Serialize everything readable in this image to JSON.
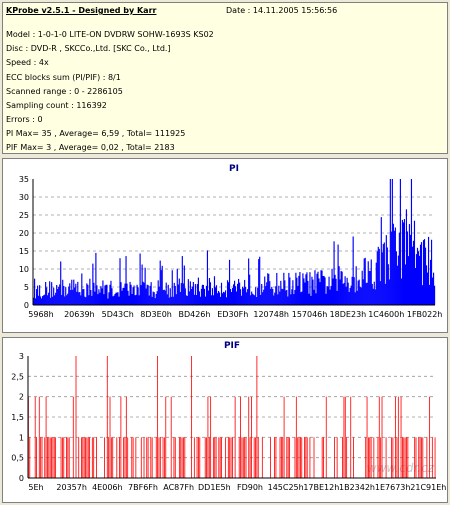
{
  "info": {
    "title": "KProbe v2.5.1 - Designed by Karr",
    "date": "Date : 14.11.2005 15:56:56",
    "lines": [
      "Model : 1-0-1-0 LITE-ON DVDRW SOHW-1693S KS02",
      "Disc : DVD-R , SKCCo.,Ltd. [SKC Co., Ltd.]",
      "Speed : 4x",
      "ECC blocks sum (PI/PIF) : 8/1",
      "Scanned range : 0 - 2286105",
      "Sampling count : 116392",
      "Errors : 0",
      "PI Max= 35 , Average= 6,59 , Total= 111925",
      "PIF Max= 3 , Average= 0,02 , Total= 2183"
    ]
  },
  "watermark": "www.cdr.cz",
  "colors": {
    "pi": "#0000ff",
    "pif": "#ff0000",
    "title": "#000080",
    "info_bg": "#ffffe1"
  },
  "chart_data": [
    {
      "type": "bar",
      "title": "PI",
      "ylim": [
        0,
        35
      ],
      "yticks": [
        "0",
        "5",
        "10",
        "15",
        "20",
        "25",
        "30",
        "35"
      ],
      "xticks": [
        "5968h",
        "20639h",
        "5D43Ch",
        "8D3E0h",
        "BD426h",
        "ED30Fh",
        "120748h",
        "157046h",
        "18DE23h",
        "1C4600h",
        "1FB022h"
      ],
      "grid": true,
      "profile": [
        [
          0,
          4.5
        ],
        [
          0.05,
          5
        ],
        [
          0.1,
          5.5
        ],
        [
          0.2,
          5
        ],
        [
          0.3,
          5
        ],
        [
          0.4,
          5.5
        ],
        [
          0.5,
          6
        ],
        [
          0.6,
          6.5
        ],
        [
          0.7,
          7
        ],
        [
          0.75,
          7.5
        ],
        [
          0.8,
          9
        ],
        [
          0.85,
          12
        ],
        [
          0.88,
          15
        ],
        [
          0.9,
          18
        ],
        [
          0.93,
          20
        ],
        [
          0.96,
          16
        ],
        [
          1.0,
          12
        ]
      ],
      "max": 35,
      "average": 6.59
    },
    {
      "type": "bar",
      "title": "PIF",
      "ylim": [
        0,
        3
      ],
      "yticks": [
        "0",
        "0,5",
        "1",
        "1,5",
        "2",
        "2,5",
        "3"
      ],
      "xticks": [
        "5Eh",
        "20357h",
        "4E006h",
        "7BF6Fh",
        "AC87Fh",
        "DD1E5h",
        "FD90h",
        "145C25h",
        "17BE12h",
        "1B2342h",
        "1E7673h",
        "21C91Eh"
      ],
      "grid": true,
      "max": 3,
      "average": 0.02
    }
  ]
}
